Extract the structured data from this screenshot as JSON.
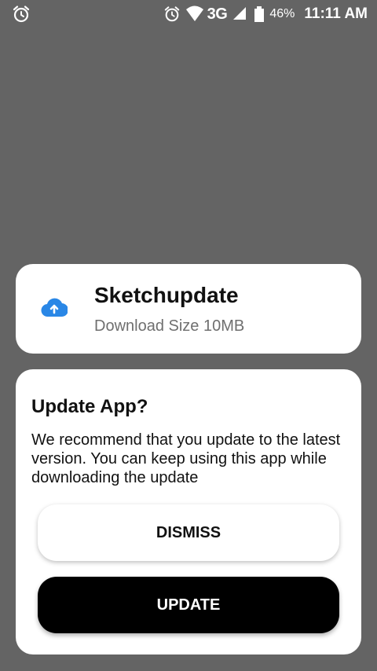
{
  "status_bar": {
    "network_type": "3G",
    "battery_percent": "46%",
    "time": "11:11 AM",
    "icons": [
      "alarm-icon",
      "alarm-icon",
      "wifi-icon",
      "signal-icon",
      "battery-icon"
    ]
  },
  "app": {
    "name": "Sketchupdate",
    "download_size": "Download Size 10MB",
    "icon": "cloud-upload-icon",
    "icon_color": "#2a87e6"
  },
  "dialog": {
    "title": "Update App?",
    "message": "We recommend that you update to the latest version. You can keep using this app while downloading the update",
    "dismiss_label": "DISMISS",
    "update_label": "UPDATE"
  },
  "colors": {
    "backdrop": "#646464",
    "card": "#ffffff",
    "primary_button": "#000000"
  }
}
